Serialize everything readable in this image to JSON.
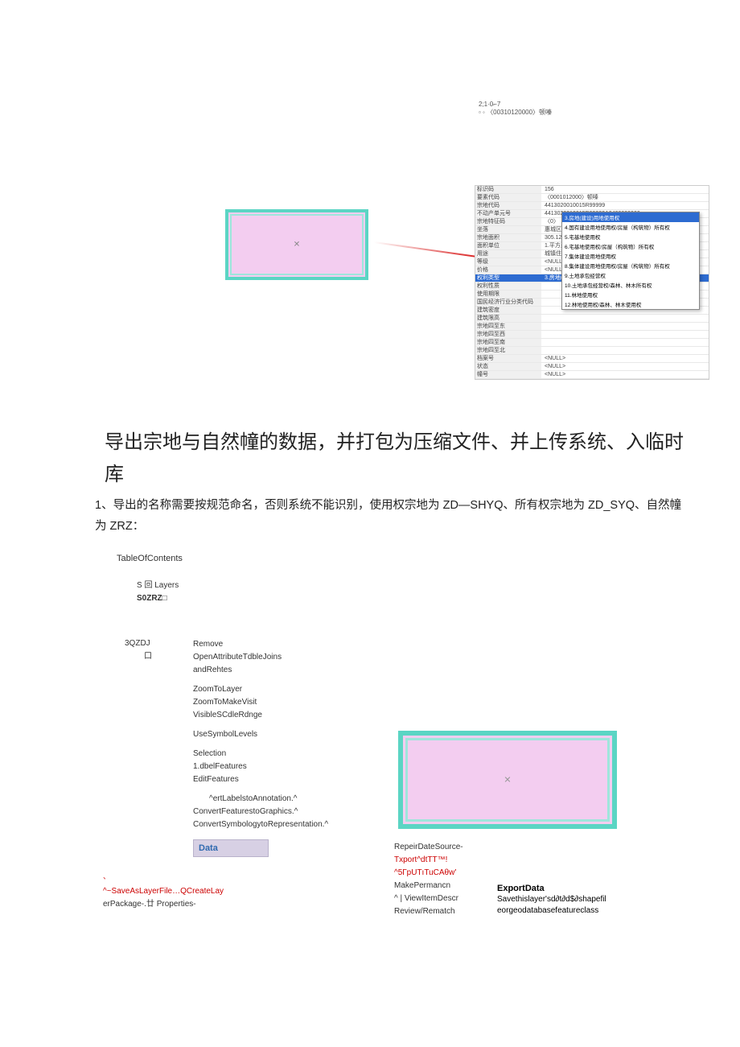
{
  "top_header": {
    "line1": "2;1·0⌐7",
    "line2": "▫ ◦ 〈00310120000〉顿嗪"
  },
  "panel_rows": [
    {
      "k": "标识码",
      "v": "156"
    },
    {
      "k": "要素代码",
      "v": "〈0001012000〉顿嗪"
    },
    {
      "k": "宗地代码",
      "v": "4413020010015R99999"
    },
    {
      "k": "不动产单元号",
      "v": "4413020010015R99999A0400000000"
    },
    {
      "k": "宗地特征码",
      "v": "〈0〉"
    },
    {
      "k": "坐落",
      "v": "惠城区惠环街道雅居乐江南测试11号小"
    },
    {
      "k": "宗地面积",
      "v": "305.129956"
    },
    {
      "k": "面积单位",
      "v": "1.平方米"
    },
    {
      "k": "用途",
      "v": "城镇住宅用地"
    },
    {
      "k": "等级",
      "v": "<NULL>"
    },
    {
      "k": "价格",
      "v": "<NULL>"
    },
    {
      "k": "权利类型",
      "v": "3.房地(建设)用地使用权",
      "sel": true
    },
    {
      "k": "权利性质",
      "v": ""
    },
    {
      "k": "使用期限",
      "v": ""
    },
    {
      "k": "国民经济行业分类代码",
      "v": ""
    },
    {
      "k": "建筑密度",
      "v": ""
    },
    {
      "k": "建筑限高",
      "v": ""
    },
    {
      "k": "宗地四至东",
      "v": ""
    },
    {
      "k": "宗地四至西",
      "v": ""
    },
    {
      "k": "宗地四至南",
      "v": ""
    },
    {
      "k": "宗地四至北",
      "v": ""
    },
    {
      "k": "档案号",
      "v": "<NULL>"
    },
    {
      "k": "状态",
      "v": "<NULL>"
    },
    {
      "k": "幢号",
      "v": "<NULL>"
    }
  ],
  "dropdown": [
    {
      "t": "3.房地(建设)用地使用权",
      "sel": true
    },
    {
      "t": "4.国有建设用地使用权/房屋（构筑物）所有权"
    },
    {
      "t": "5.宅基地使用权"
    },
    {
      "t": "6.宅基地使用权/房屋（构筑物）所有权"
    },
    {
      "t": "7.集体建设用地使用权"
    },
    {
      "t": "8.集体建设用地使用权/房屋（构筑物）所有权"
    },
    {
      "t": "9.土地承包经营权"
    },
    {
      "t": "10.土地承包经营权/森林、林木所有权"
    },
    {
      "t": "11.林地使用权"
    },
    {
      "t": "12.林地使用权/森林、林木使用权"
    }
  ],
  "main_text": "导出宗地与自然幢的数据，并打包为压缩文件、并上传系统、入临时库",
  "rule_text": "1、导出的名称需要按规范命名，否则系统不能识别，使用权宗地为 ZD—SHYQ、所有权宗地为 ZD_SYQ、自然幢为 ZRZ：",
  "toc_title": "TableOfContents",
  "toc_lines": {
    "l1": "S 回 Layers",
    "l2": "S0ZRZ□"
  },
  "qzdj": {
    "l1": "3QZDJ",
    "l2": "口"
  },
  "context_menu": {
    "remove": "Remove",
    "open": "OpenAttributeTdbleJoins",
    "and": "andRehtes",
    "zoom_layer": "ZoomToLayer",
    "zoom_make": "ZoomToMakeVisit",
    "vis": "VisibleSCdleRdnge",
    "sym": "UseSymbolLevels",
    "selection": "Selection",
    "dbel": "1.dbelFeatures",
    "edit": "EditFeatures",
    "ann": "^ertLabelstoAnnotation.^",
    "conv_g": "ConvertFeaturestoGraphics.^",
    "conv_r": "ConvertSymbologytoRepresentation.^",
    "data_btn": "Data"
  },
  "pkg": {
    "save": "^~SaveAsLayerFile…QCreateLay",
    "pkg2": "erPackage-.廿  Properties-"
  },
  "right_notes": {
    "l1": "RepeirDateSource-",
    "l2": "Txport^dtTT™!",
    "l3": "^5ГpUTıTuCAθw′",
    "l4": "MakePermancn",
    "l5": "^  |  ViewItemDescr",
    "l6": "Review/Rematch"
  },
  "export": {
    "h": "ExportData",
    "d1": "Savethislayer'sd∂t∂d$∂shapefil",
    "d2": "eorgeodatabasefeatureclass"
  }
}
